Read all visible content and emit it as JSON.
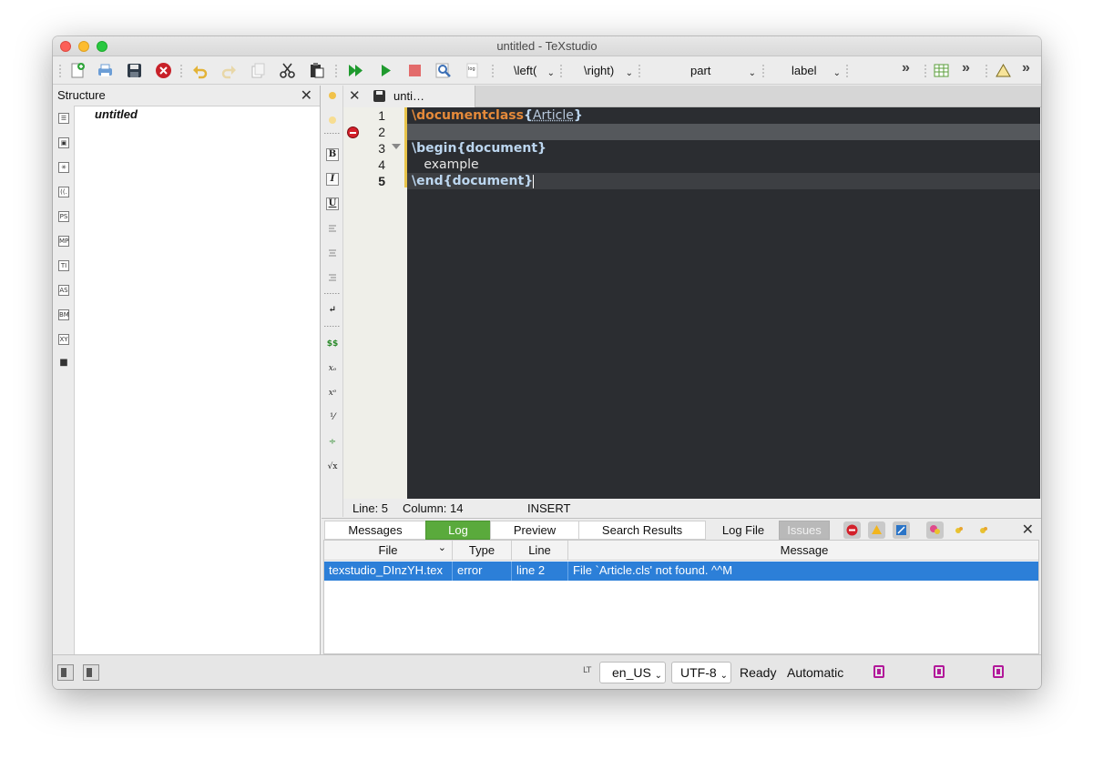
{
  "window": {
    "title": "untitled - TeXstudio"
  },
  "toolbar": {
    "combos": [
      {
        "label": "\\left("
      },
      {
        "label": "\\right)"
      },
      {
        "label": "part"
      },
      {
        "label": "label"
      }
    ],
    "chevron": "⌄",
    "more": "»"
  },
  "structure": {
    "title": "Structure",
    "close": "✕",
    "tree_root": "untitled",
    "side_buttons": [
      "☰",
      "▣",
      "✳",
      "((.",
      "PS",
      "MP",
      "TI",
      "AS",
      "BM",
      "XY",
      "■"
    ]
  },
  "editor_tools": {
    "bold": "B",
    "italic": "I",
    "underline": "U",
    "newline": "↵",
    "math": "$$",
    "subscript": "xₒ",
    "superscript": "xᵒ",
    "frac": "⅟",
    "dfrac": "÷",
    "sqrt": "√x"
  },
  "tab": {
    "close": "✕",
    "label": "unti…"
  },
  "editor": {
    "line_numbers": [
      "1",
      "2",
      "3",
      "4",
      "5"
    ],
    "line1": {
      "cmd": "\\documentclass",
      "open": "{",
      "arg": "Article",
      "close": "}"
    },
    "line3": {
      "cmd": "\\begin{document}"
    },
    "line4": {
      "text": "   example"
    },
    "line5": {
      "cmd": "\\end{document}"
    }
  },
  "edit_status": {
    "line": "Line: 5",
    "column": "Column: 14",
    "mode": "INSERT"
  },
  "bottom_panel": {
    "tabs": [
      "Messages",
      "Log",
      "Preview",
      "Search Results",
      "Log File",
      "Issues"
    ],
    "active_tab": "Log",
    "close": "✕",
    "columns": [
      "File",
      "Type",
      "Line",
      "Message"
    ],
    "sort_indicator": "⌄",
    "rows": [
      {
        "file": "texstudio_DInzYH.tex",
        "type": "error",
        "line": "line 2",
        "message": "File `Article.cls' not found. ^^M"
      }
    ]
  },
  "statusbar": {
    "lt_label": "LT",
    "language": "en_US",
    "encoding": "UTF-8",
    "state": "Ready",
    "mode": "Automatic",
    "chevron": "⌄"
  },
  "colors": {
    "editor_bg": "#2b2d31",
    "keyword_orange": "#e58a3a",
    "keyword_blue": "#bcd6ef",
    "selection_blue": "#2c7fd8",
    "log_active_green": "#5aaa3c",
    "error_red": "#d3202a"
  }
}
